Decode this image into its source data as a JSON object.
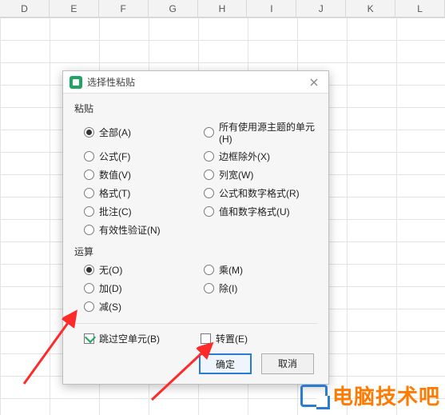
{
  "columns": [
    "D",
    "E",
    "F",
    "G",
    "H",
    "I",
    "J",
    "K",
    "L"
  ],
  "dialog": {
    "title": "选择性粘贴",
    "close_aria": "Close",
    "paste_section": "粘贴",
    "paste_options_left": [
      {
        "label": "全部(A)",
        "selected": true
      },
      {
        "label": "公式(F)",
        "selected": false
      },
      {
        "label": "数值(V)",
        "selected": false
      },
      {
        "label": "格式(T)",
        "selected": false
      },
      {
        "label": "批注(C)",
        "selected": false
      },
      {
        "label": "有效性验证(N)",
        "selected": false
      }
    ],
    "paste_options_right": [
      {
        "label": "所有使用源主题的单元(H)",
        "selected": false
      },
      {
        "label": "边框除外(X)",
        "selected": false
      },
      {
        "label": "列宽(W)",
        "selected": false
      },
      {
        "label": "公式和数字格式(R)",
        "selected": false
      },
      {
        "label": "值和数字格式(U)",
        "selected": false
      }
    ],
    "op_section": "运算",
    "op_left": [
      {
        "label": "无(O)",
        "selected": true
      },
      {
        "label": "加(D)",
        "selected": false
      },
      {
        "label": "减(S)",
        "selected": false
      }
    ],
    "op_right": [
      {
        "label": "乘(M)",
        "selected": false
      },
      {
        "label": "除(I)",
        "selected": false
      }
    ],
    "skip_blanks": {
      "label": "跳过空单元(B)",
      "checked": true
    },
    "transpose": {
      "label": "转置(E)",
      "checked": false
    },
    "ok": "确定",
    "cancel": "取消"
  },
  "watermark": "电脑技术吧"
}
